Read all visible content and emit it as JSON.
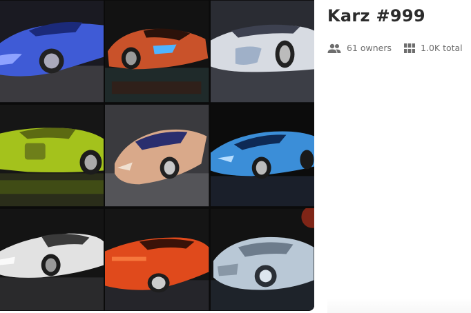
{
  "collection": {
    "title": "Karz #999",
    "owners_label": "61 owners",
    "total_label": "1.0K total",
    "owners_icon": "people-icon",
    "total_icon": "grid-icon"
  },
  "tiles": [
    {
      "name": "blue-supercar-render",
      "body": "#3f5bd6",
      "bg": "#1a1a22"
    },
    {
      "name": "orange-supercar-render",
      "body": "#c9522a",
      "bg": "#121212"
    },
    {
      "name": "silver-supercar-render",
      "body": "#d7dbe2",
      "bg": "#2a2c33"
    },
    {
      "name": "lime-supercar-render",
      "body": "#a4c21c",
      "bg": "#161616"
    },
    {
      "name": "gold-supercar-render",
      "body": "#d9a98a",
      "bg": "#3a3a3e"
    },
    {
      "name": "cyan-supercar-render",
      "body": "#3b8ed8",
      "bg": "#0c0c0c"
    },
    {
      "name": "white-supercar-render",
      "body": "#e2e2e2",
      "bg": "#141414"
    },
    {
      "name": "red-supercar-render",
      "body": "#e04a1c",
      "bg": "#151515"
    },
    {
      "name": "chrome-supercar-render",
      "body": "#b9c8d6",
      "bg": "#121212"
    }
  ]
}
